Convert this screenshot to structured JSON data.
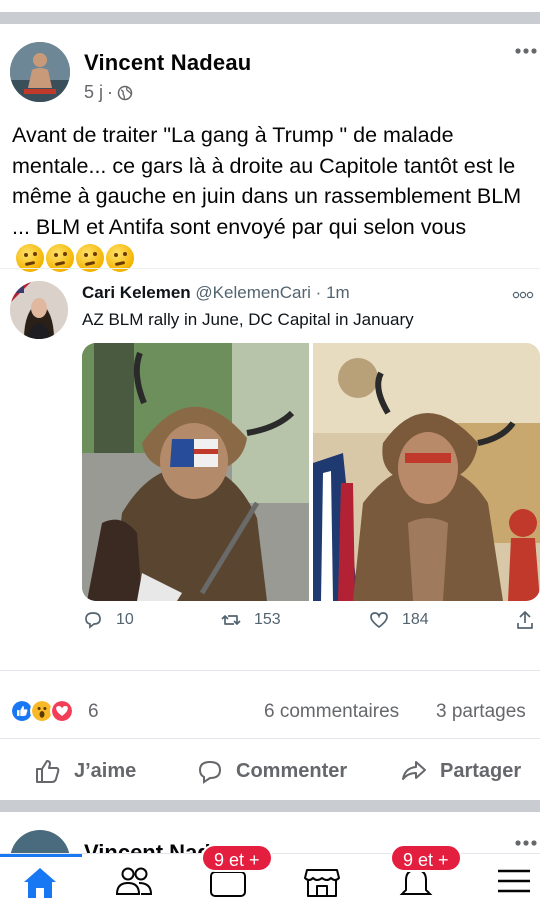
{
  "post": {
    "author": "Vincent Nadeau",
    "time": "5 j",
    "separator": "·",
    "privacy_icon": "globe-icon",
    "text": "Avant de traiter \"La gang à Trump \" de malade mentale... ce gars là à droite au Capitole tantôt est le même à gauche en juin dans un rassemblement BLM ... BLM et Antifa sont envoyé par qui selon vous",
    "emojis": [
      "thinking-face-emoji",
      "thinking-face-emoji",
      "thinking-face-emoji",
      "thinking-face-emoji"
    ]
  },
  "tweet": {
    "author": "Cari Kelemen",
    "handle": "@KelemenCari",
    "separator": "·",
    "time": "1m",
    "text": "AZ BLM rally in June, DC Capital in January",
    "replies": "10",
    "retweets": "153",
    "likes": "184"
  },
  "reactions": {
    "count": "6",
    "comments": "6 commentaires",
    "shares": "3 partages",
    "types": [
      "like",
      "wow",
      "love"
    ]
  },
  "actions": {
    "like": "J’aime",
    "comment": "Commenter",
    "share": "Partager"
  },
  "next_post": {
    "author": "Vincent Nadeau"
  },
  "bottom_nav": {
    "badge_groups": "9 et +",
    "badge_notifications": "9 et +",
    "items": [
      "home-icon",
      "friends-icon",
      "watch-icon",
      "marketplace-icon",
      "notifications-icon",
      "menu-icon"
    ]
  },
  "colors": {
    "brand_blue": "#1877f2",
    "badge_red": "#e41e3f",
    "divider_gray": "#c9ccd1",
    "text_secondary": "#65676b",
    "twitter_gray": "#536471"
  }
}
